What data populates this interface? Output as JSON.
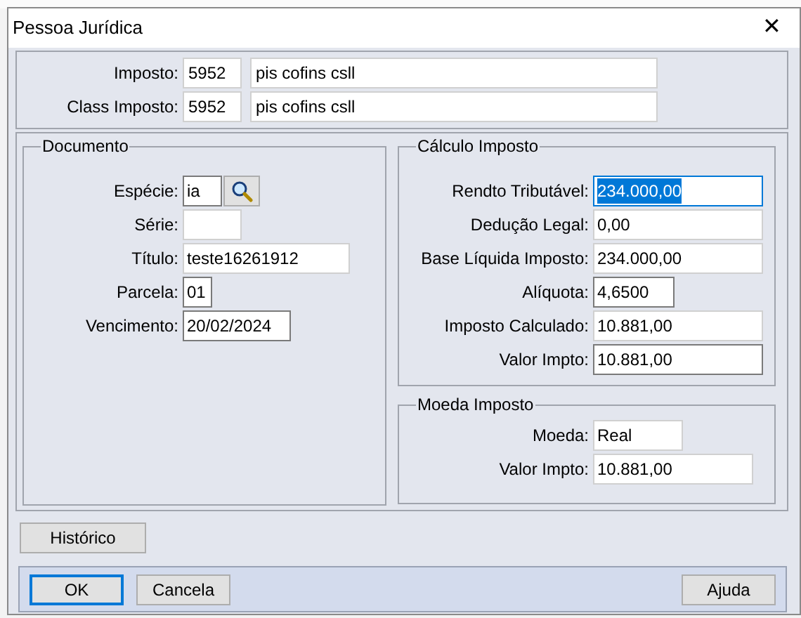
{
  "window": {
    "title": "Pessoa Jurídica",
    "close": "✕"
  },
  "header": {
    "rows": [
      {
        "label": "Imposto:",
        "code": "5952",
        "description": "pis cofins csll"
      },
      {
        "label": "Class Imposto:",
        "code": "5952",
        "description": "pis cofins csll"
      }
    ]
  },
  "documento": {
    "title": "Documento",
    "fields": [
      {
        "label": "Espécie:",
        "value": "ia",
        "editable": true,
        "focused": false,
        "lookup": true
      },
      {
        "label": "Série:",
        "editable": false,
        "focused": false,
        "lookup": false
      },
      {
        "label": "Título:",
        "value": "teste16261912",
        "editable": false,
        "focused": false,
        "lookup": false
      },
      {
        "label": "Parcela:",
        "value": "01",
        "editable": true,
        "focused": false,
        "lookup": false
      },
      {
        "label": "Vencimento:",
        "value": "20/02/2024",
        "editable": true,
        "focused": false,
        "lookup": false
      }
    ]
  },
  "calculo_imposto": {
    "title": "Cálculo Imposto",
    "fields": [
      {
        "label": "Rendto Tributável:",
        "value": "234.000,00",
        "editable": true,
        "focused": true,
        "lookup": false
      },
      {
        "label": "Dedução Legal:",
        "value": "0,00",
        "editable": false,
        "focused": false,
        "lookup": false
      },
      {
        "label": "Base Líquida Imposto:",
        "value": "234.000,00",
        "editable": false,
        "focused": false,
        "lookup": false
      },
      {
        "label": "Alíquota:",
        "value": "4,6500",
        "editable": true,
        "focused": false,
        "lookup": false
      },
      {
        "label": "Imposto Calculado:",
        "value": "10.881,00",
        "editable": false,
        "focused": false,
        "lookup": false
      },
      {
        "label": "Valor Impto:",
        "value": "10.881,00",
        "editable": true,
        "focused": false,
        "lookup": false
      }
    ]
  },
  "moeda_imposto": {
    "title": "Moeda Imposto",
    "fields": [
      {
        "label": "Moeda:",
        "value": "Real",
        "editable": false,
        "focused": false,
        "lookup": false
      },
      {
        "label": "Valor Impto:",
        "value": "10.881,00",
        "editable": false,
        "focused": false,
        "lookup": false
      }
    ]
  },
  "historico_button": "Histórico",
  "footer": {
    "buttons": [
      {
        "label": "OK",
        "default": true
      },
      {
        "label": "Cancela",
        "default": false
      },
      {
        "label": "Ajuda",
        "default": false
      }
    ]
  }
}
